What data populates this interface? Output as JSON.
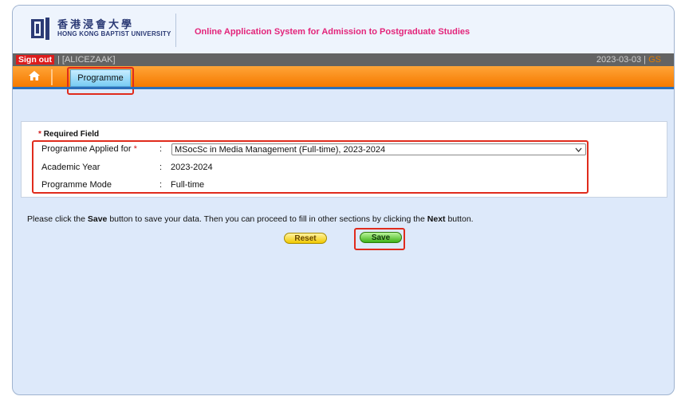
{
  "header": {
    "university_zh": "香港浸會大學",
    "university_en": "HONG KONG BAPTIST UNIVERSITY",
    "system_title": "Online Application System for Admission to Postgraduate Studies"
  },
  "userbar": {
    "signout_label": "Sign out",
    "username": "| [ALICEZAAK]",
    "date": "2023-03-03 |",
    "lang": "GS"
  },
  "nav": {
    "home_icon": "home-icon",
    "tab_label": "Programme"
  },
  "form": {
    "required_star": "*",
    "required_text": "Required Field",
    "rows": [
      {
        "label": "Programme Applied for",
        "star": "*",
        "colon": ":",
        "value": "MSocSc in Media Management (Full-time), 2023-2024"
      },
      {
        "label": "Academic Year",
        "colon": ":",
        "value": "2023-2024"
      },
      {
        "label": "Programme Mode",
        "colon": ":",
        "value": "Full-time"
      }
    ]
  },
  "instructions": {
    "part1": "Please click the ",
    "save_word": "Save",
    "part2": " button to save your data. Then you can proceed to fill in other sections by clicking the ",
    "next_word": "Next",
    "part3": " button."
  },
  "buttons": {
    "reset_label": "Reset",
    "save_label": "Save"
  },
  "colors": {
    "accent_pink": "#e3247a",
    "nav_orange": "#f57a00",
    "tab_blue": "#79cdf4",
    "highlight_red": "#e02b1c"
  }
}
